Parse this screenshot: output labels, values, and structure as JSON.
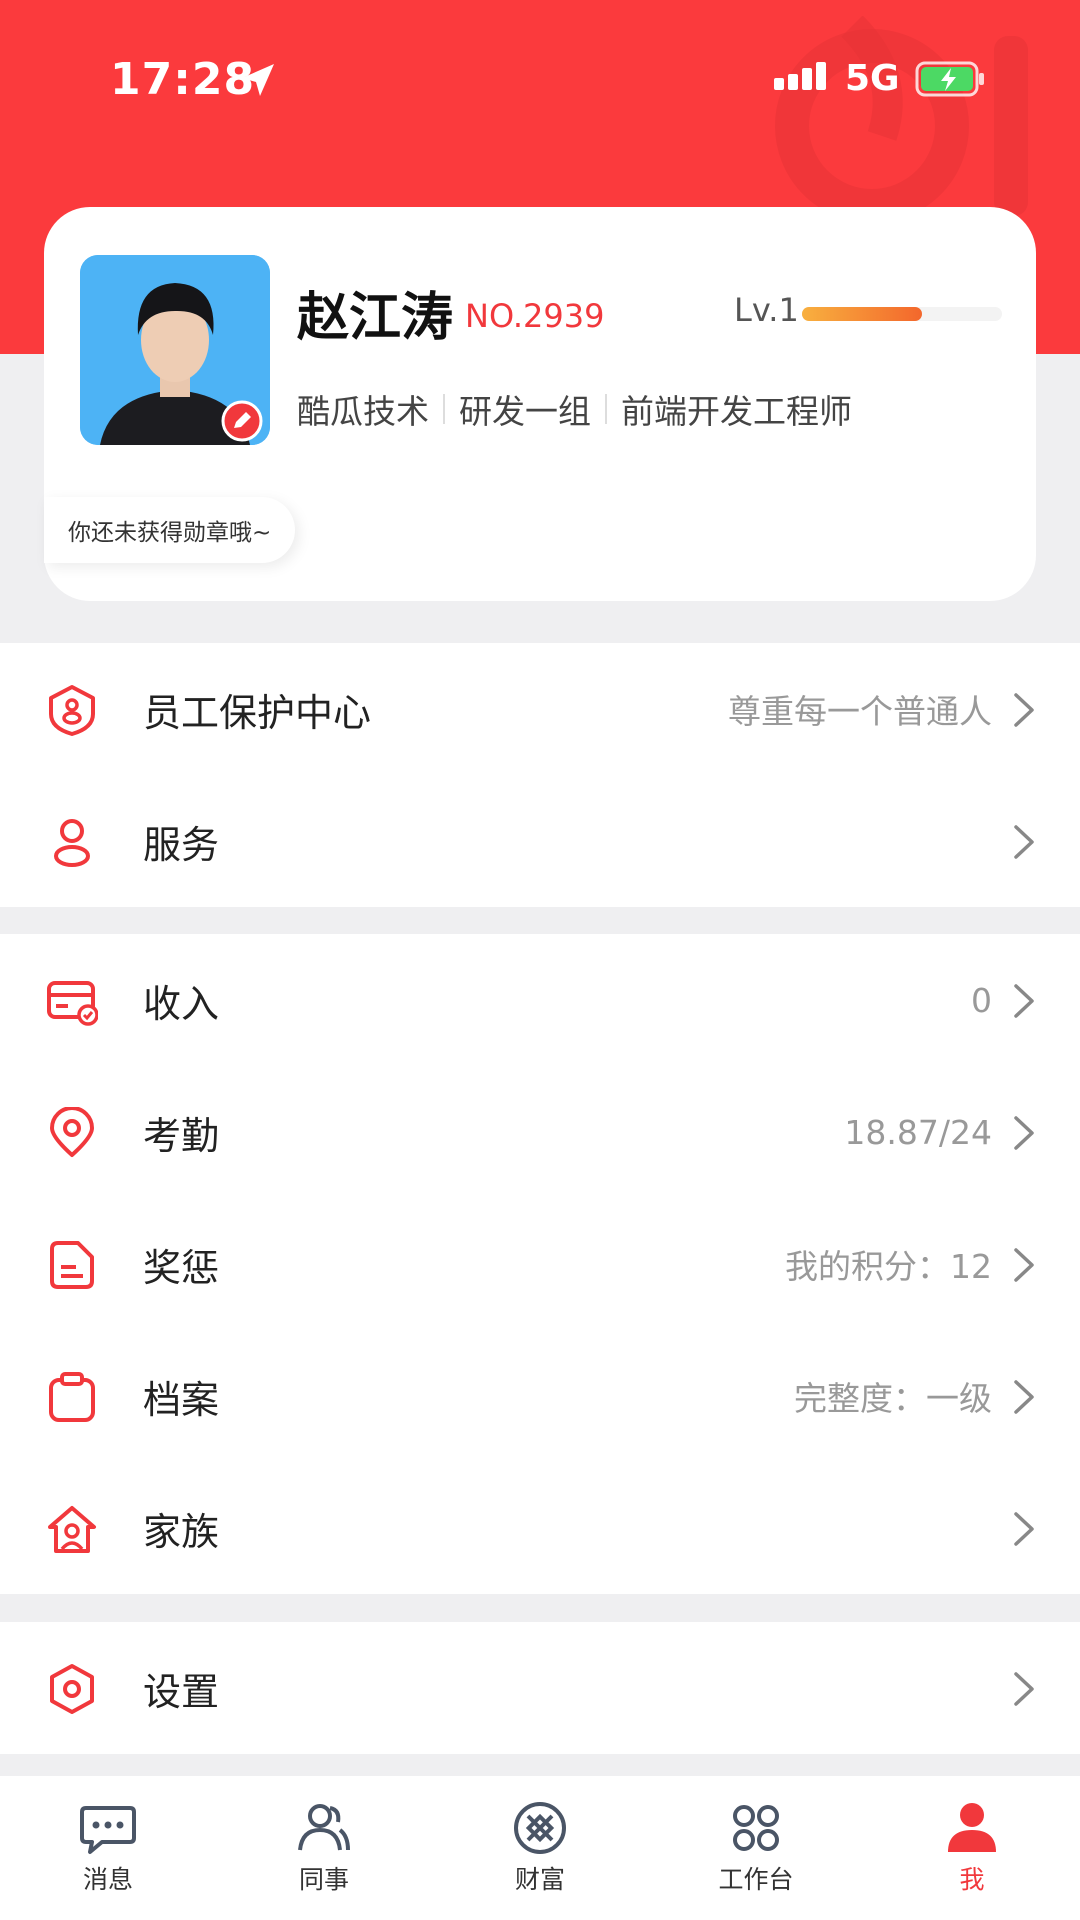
{
  "status_bar": {
    "time": "17:28",
    "network": "5G"
  },
  "profile": {
    "name": "赵江涛",
    "employee_no": "NO.2939",
    "level": "Lv.1",
    "level_progress": 0.6,
    "org": [
      "酷瓜技术",
      "研发一组",
      "前端开发工程师"
    ],
    "badge_tip": "你还未获得勋章哦~"
  },
  "menu_groups": [
    [
      {
        "label": "员工保护中心",
        "value": "尊重每一个普通人",
        "icon": "shield-icon"
      },
      {
        "label": "服务",
        "value": "",
        "icon": "person-icon"
      }
    ],
    [
      {
        "label": "收入",
        "value": "0",
        "icon": "card-icon"
      },
      {
        "label": "考勤",
        "value": "18.87/24",
        "icon": "location-pin-icon"
      },
      {
        "label": "奖惩",
        "value": "我的积分：12",
        "icon": "document-icon"
      },
      {
        "label": "档案",
        "value": "完整度：一级",
        "icon": "clipboard-icon"
      },
      {
        "label": "家族",
        "value": "",
        "icon": "home-icon"
      }
    ],
    [
      {
        "label": "设置",
        "value": "",
        "icon": "settings-hexagon-icon"
      }
    ]
  ],
  "tabs": [
    {
      "label": "消息",
      "icon": "chat-bubble-icon",
      "active": false
    },
    {
      "label": "同事",
      "icon": "colleagues-icon",
      "active": false
    },
    {
      "label": "财富",
      "icon": "wealth-icon",
      "active": false
    },
    {
      "label": "工作台",
      "icon": "workbench-icon",
      "active": false
    },
    {
      "label": "我",
      "icon": "me-icon",
      "active": true
    }
  ],
  "colors": {
    "brand_red": "#fb3a3d",
    "accent_red": "#f1383c",
    "level_bar_start": "#f8b03f",
    "level_bar_end": "#f3672c"
  }
}
